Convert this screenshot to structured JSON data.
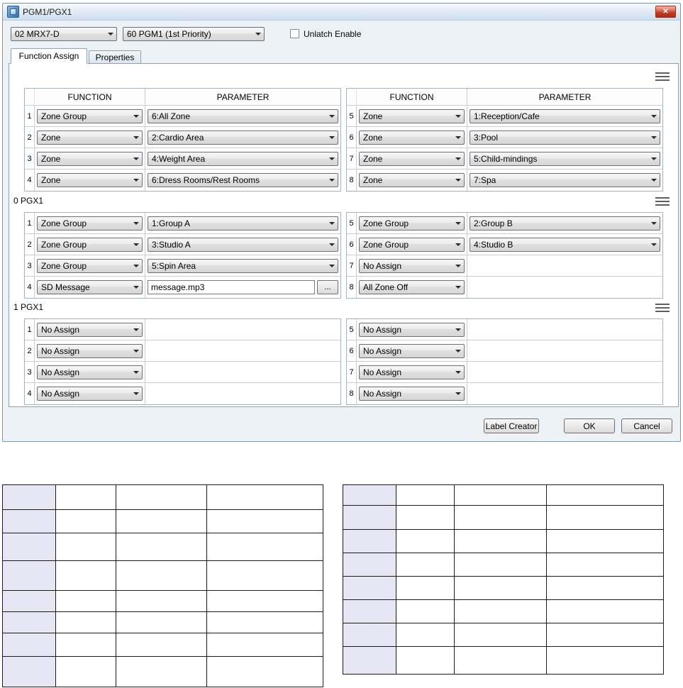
{
  "window": {
    "title": "PGM1/PGX1"
  },
  "icons": {
    "close": "✕"
  },
  "toolbar": {
    "device_combo": "02 MRX7-D",
    "source_combo": "60 PGM1 (1st Priority)",
    "unlatch_checkbox_label": "Unlatch Enable",
    "unlatch_checked": false
  },
  "tabs": [
    {
      "label": "Function Assign",
      "active": true
    },
    {
      "label": "Properties",
      "active": false
    }
  ],
  "column_headers": {
    "function": "FUNCTION",
    "parameter": "PARAMETER"
  },
  "sections": [
    {
      "label": "",
      "show_headers": true,
      "left_rows": [
        {
          "num": "1",
          "function": "Zone Group",
          "param_type": "combo",
          "parameter": "6:All Zone"
        },
        {
          "num": "2",
          "function": "Zone",
          "param_type": "combo",
          "parameter": "2:Cardio Area"
        },
        {
          "num": "3",
          "function": "Zone",
          "param_type": "combo",
          "parameter": "4:Weight Area"
        },
        {
          "num": "4",
          "function": "Zone",
          "param_type": "combo",
          "parameter": "6:Dress Rooms/Rest Rooms"
        }
      ],
      "right_rows": [
        {
          "num": "5",
          "function": "Zone",
          "param_type": "combo",
          "parameter": "1:Reception/Cafe"
        },
        {
          "num": "6",
          "function": "Zone",
          "param_type": "combo",
          "parameter": "3:Pool"
        },
        {
          "num": "7",
          "function": "Zone",
          "param_type": "combo",
          "parameter": "5:Child-mindings"
        },
        {
          "num": "8",
          "function": "Zone",
          "param_type": "combo",
          "parameter": "7:Spa"
        }
      ]
    },
    {
      "label": "0 PGX1",
      "show_headers": false,
      "left_rows": [
        {
          "num": "1",
          "function": "Zone Group",
          "param_type": "combo",
          "parameter": "1:Group A"
        },
        {
          "num": "2",
          "function": "Zone Group",
          "param_type": "combo",
          "parameter": "3:Studio A"
        },
        {
          "num": "3",
          "function": "Zone Group",
          "param_type": "combo",
          "parameter": "5:Spin Area"
        },
        {
          "num": "4",
          "function": "SD Message",
          "param_type": "file",
          "parameter": "message.mp3",
          "browse_label": "..."
        }
      ],
      "right_rows": [
        {
          "num": "5",
          "function": "Zone Group",
          "param_type": "combo",
          "parameter": "2:Group B"
        },
        {
          "num": "6",
          "function": "Zone Group",
          "param_type": "combo",
          "parameter": "4:Studio B"
        },
        {
          "num": "7",
          "function": "No Assign",
          "param_type": "none",
          "parameter": ""
        },
        {
          "num": "8",
          "function": "All Zone Off",
          "param_type": "none",
          "parameter": ""
        }
      ]
    },
    {
      "label": "1 PGX1",
      "show_headers": false,
      "left_rows": [
        {
          "num": "1",
          "function": "No Assign",
          "param_type": "none",
          "parameter": ""
        },
        {
          "num": "2",
          "function": "No Assign",
          "param_type": "none",
          "parameter": ""
        },
        {
          "num": "3",
          "function": "No Assign",
          "param_type": "none",
          "parameter": ""
        },
        {
          "num": "4",
          "function": "No Assign",
          "param_type": "none",
          "parameter": ""
        }
      ],
      "right_rows": [
        {
          "num": "5",
          "function": "No Assign",
          "param_type": "none",
          "parameter": ""
        },
        {
          "num": "6",
          "function": "No Assign",
          "param_type": "none",
          "parameter": ""
        },
        {
          "num": "7",
          "function": "No Assign",
          "param_type": "none",
          "parameter": ""
        },
        {
          "num": "8",
          "function": "No Assign",
          "param_type": "none",
          "parameter": ""
        }
      ]
    }
  ],
  "footer_buttons": {
    "label_creator": "Label Creator",
    "ok": "OK",
    "cancel": "Cancel"
  },
  "bottom_tables": [
    {
      "rows": 8,
      "cols": 4
    },
    {
      "rows": 8,
      "cols": 4
    }
  ]
}
